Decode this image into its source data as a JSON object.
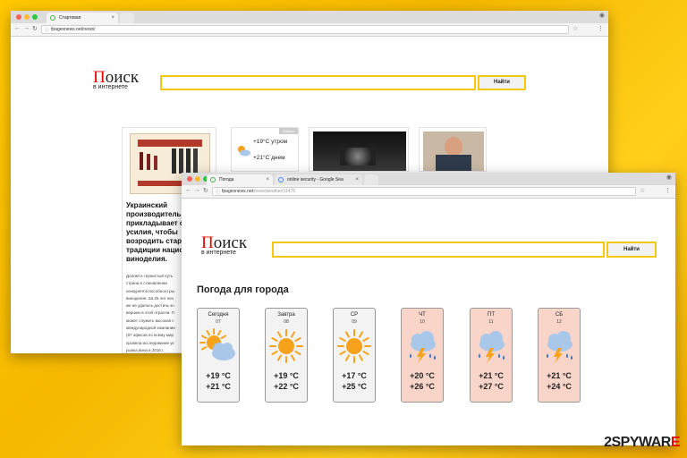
{
  "back_window": {
    "tab_title": "Стартовая",
    "url": "fpagesnews.net/news/",
    "logo_main": "Поиск",
    "logo_first_letter": "П",
    "logo_rest": "оиск",
    "logo_sub": "в интернете",
    "search_button": "Найти",
    "weather_widget": {
      "temp_morning": "+19°С утром",
      "temp_day": "+21°С днем",
      "badge": "Завтра"
    },
    "article": {
      "headline": "Украинский производитель прикладывает с усилия, чтобы возродить стар традиции нацио виноделия.",
      "headline_lines": [
        "Украинский",
        "производитель",
        "прикладывает с",
        "усилия, чтобы",
        "возродить стар",
        "традиции нацио",
        "виноделия."
      ],
      "body_lines": [
        "Долгий и тернистый путь",
        "страна в становлении",
        "конкурентоспособного ры",
        "виноделия. За 25 лет нез",
        "же не удалось достичь зн",
        "вершин в этой отрасли. П",
        "может служить высокая с",
        "международной компании",
        "(87 офисов по всему мир",
        "провела исследование ук",
        "рынка вина в 2016 г."
      ]
    }
  },
  "front_window": {
    "tab1_title": "Погода",
    "tab2_title": "online security - Google Sea",
    "url_main": "fpagesnews.net",
    "url_path": "/news/weather/11476",
    "logo_first_letter": "П",
    "logo_rest": "оиск",
    "logo_sub": "в интернете",
    "search_button": "Найти",
    "heading": "Погода для города",
    "days": [
      {
        "name": "Сегодня",
        "date": "07",
        "icon": "partly-cloudy-icon",
        "t1": "+19 °C",
        "t2": "+21 °C",
        "style": "light"
      },
      {
        "name": "Завтра",
        "date": "08",
        "icon": "sun-icon",
        "t1": "+19 °C",
        "t2": "+22 °C",
        "style": "light"
      },
      {
        "name": "СР",
        "date": "09",
        "icon": "sun-icon",
        "t1": "+17 °C",
        "t2": "+25 °C",
        "style": "light"
      },
      {
        "name": "ЧТ",
        "date": "10",
        "icon": "storm-icon",
        "t1": "+20 °C",
        "t2": "+26 °C",
        "style": "storm"
      },
      {
        "name": "ПТ",
        "date": "11",
        "icon": "storm-icon",
        "t1": "+21 °C",
        "t2": "+27 °C",
        "style": "storm"
      },
      {
        "name": "СБ",
        "date": "12",
        "icon": "storm-icon",
        "t1": "+21 °C",
        "t2": "+24 °C",
        "style": "storm"
      }
    ]
  },
  "watermark": {
    "part1": "2SPYWAR",
    "part2": "E"
  },
  "colors": {
    "background": "#ffc800",
    "accent": "#f3c80f",
    "logo_red": "#e00000",
    "storm_card": "#f8d5c8"
  }
}
